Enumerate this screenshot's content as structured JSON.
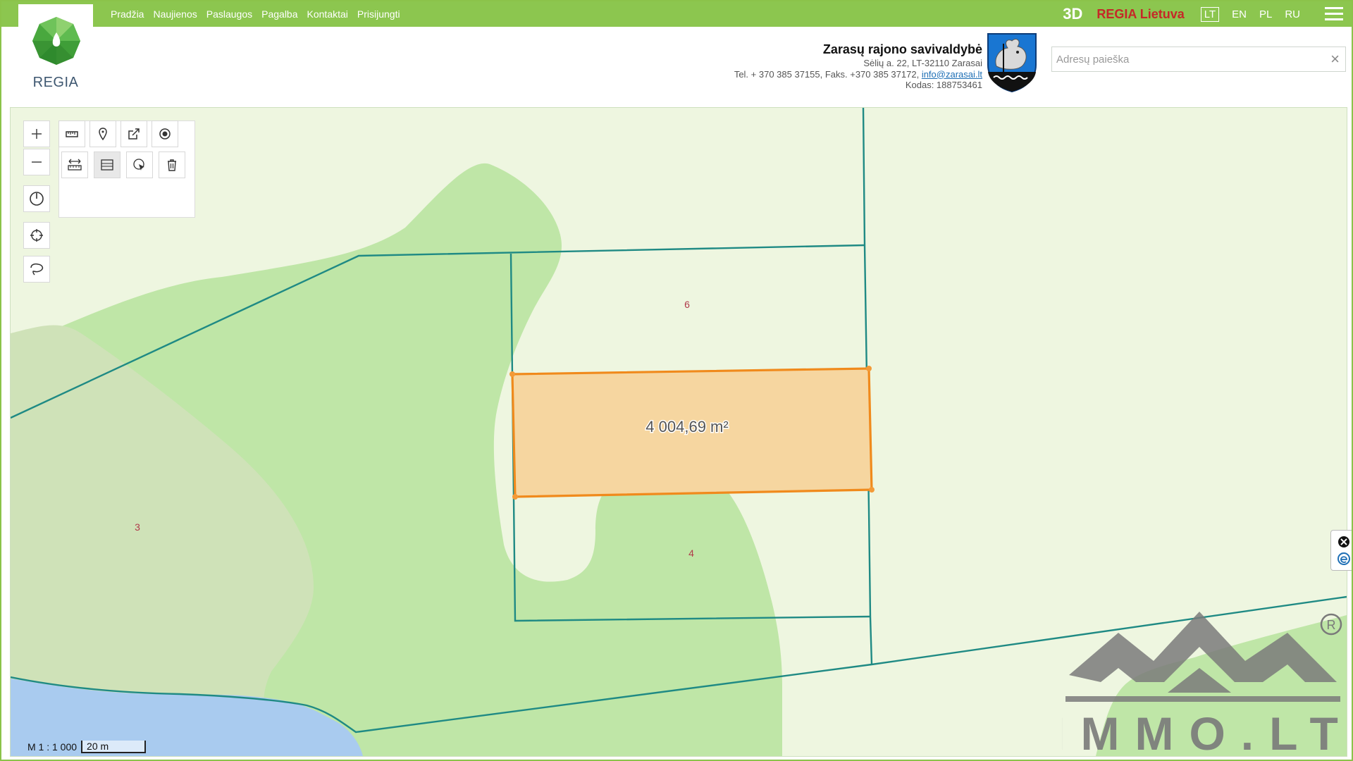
{
  "nav": {
    "items": [
      "Pradžia",
      "Naujienos",
      "Paslaugos",
      "Pagalba",
      "Kontaktai",
      "Prisijungti"
    ]
  },
  "logo": {
    "text": "REGIA"
  },
  "header_right": {
    "btn_3d": "3D",
    "regia_lietuva": "REGIA Lietuva",
    "languages": [
      "LT",
      "EN",
      "PL",
      "RU"
    ],
    "active_language": "LT"
  },
  "municipality": {
    "name": "Zarasų rajono savivaldybė",
    "address": "Sėlių a. 22, LT-32110 Zarasai",
    "phone_prefix": "Tel. + 370 385 37155, Faks. +370 385 37172,",
    "email": "info@zarasai.lt",
    "code": "Kodas: 188753461"
  },
  "search": {
    "placeholder": "Adresų paieška",
    "value": ""
  },
  "map": {
    "selected_area_label": "4 004,69 m²",
    "plot_labels": {
      "a": "6",
      "b": "4",
      "c": "3"
    },
    "scale_ratio": "M 1 : 1 000",
    "scale_bar": "20 m",
    "colors": {
      "background": "#eef6e0",
      "forest": "#bfe6a7",
      "meadow": "#cfe2b8",
      "water": "#a9cbef",
      "parcel_line": "#1f8a84",
      "selection_fill": "#f6d6a0",
      "selection_stroke": "#f08a1c"
    }
  },
  "watermark": {
    "text": "IMMO.LT"
  },
  "icons": {
    "zoom_in": "plus-icon",
    "zoom_out": "minus-icon",
    "measure_length": "ruler-icon",
    "marker": "map-pin-icon",
    "share": "share-icon",
    "record": "target-icon",
    "measure_distance": "measure-distance-icon",
    "measure_area": "measure-area-icon",
    "select": "cursor-select-icon",
    "delete": "trash-icon",
    "history": "clock-icon",
    "locate": "crosshair-icon",
    "lasso": "lasso-icon"
  }
}
